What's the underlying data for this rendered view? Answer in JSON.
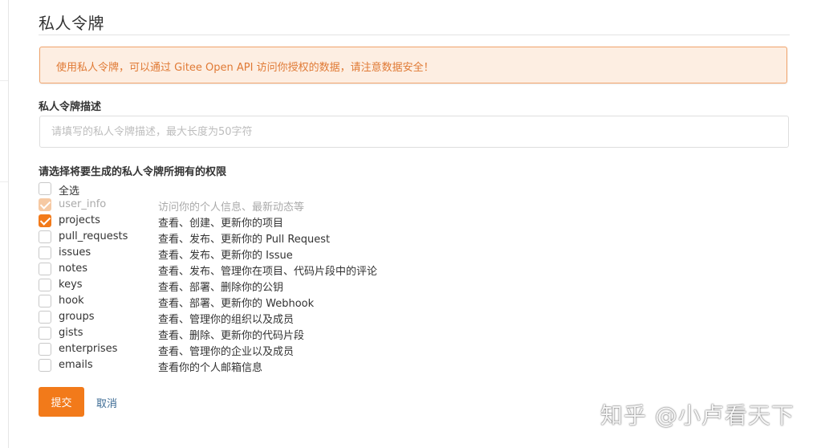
{
  "page_title": "私人令牌",
  "alert": {
    "text": "使用私人令牌，可以通过 Gitee Open API 访问你授权的数据，请注意数据安全！"
  },
  "description": {
    "label": "私人令牌描述",
    "placeholder": "请填写的私人令牌描述，最大长度为50字符",
    "value": ""
  },
  "permissions": {
    "label": "请选择将要生成的私人令牌所拥有的权限",
    "select_all_label": "全选",
    "select_all_checked": false,
    "items": [
      {
        "name": "user_info",
        "desc": "访问你的个人信息、最新动态等",
        "checked": true,
        "disabled": true
      },
      {
        "name": "projects",
        "desc": "查看、创建、更新你的项目",
        "checked": true,
        "disabled": false
      },
      {
        "name": "pull_requests",
        "desc": "查看、发布、更新你的 Pull Request",
        "checked": false,
        "disabled": false
      },
      {
        "name": "issues",
        "desc": "查看、发布、更新你的 Issue",
        "checked": false,
        "disabled": false
      },
      {
        "name": "notes",
        "desc": "查看、发布、管理你在项目、代码片段中的评论",
        "checked": false,
        "disabled": false
      },
      {
        "name": "keys",
        "desc": "查看、部署、删除你的公钥",
        "checked": false,
        "disabled": false
      },
      {
        "name": "hook",
        "desc": "查看、部署、更新你的 Webhook",
        "checked": false,
        "disabled": false
      },
      {
        "name": "groups",
        "desc": "查看、管理你的组织以及成员",
        "checked": false,
        "disabled": false
      },
      {
        "name": "gists",
        "desc": "查看、删除、更新你的代码片段",
        "checked": false,
        "disabled": false
      },
      {
        "name": "enterprises",
        "desc": "查看、管理你的企业以及成员",
        "checked": false,
        "disabled": false
      },
      {
        "name": "emails",
        "desc": "查看你的个人邮箱信息",
        "checked": false,
        "disabled": false
      }
    ]
  },
  "actions": {
    "submit_label": "提交",
    "cancel_label": "取消"
  },
  "watermark": "知乎 @小卢看天下",
  "colors": {
    "accent": "#f27a1a",
    "alert_bg": "#fdeee2",
    "alert_border": "#f0a36b",
    "alert_text": "#e07a35",
    "link": "#3c6b94"
  }
}
